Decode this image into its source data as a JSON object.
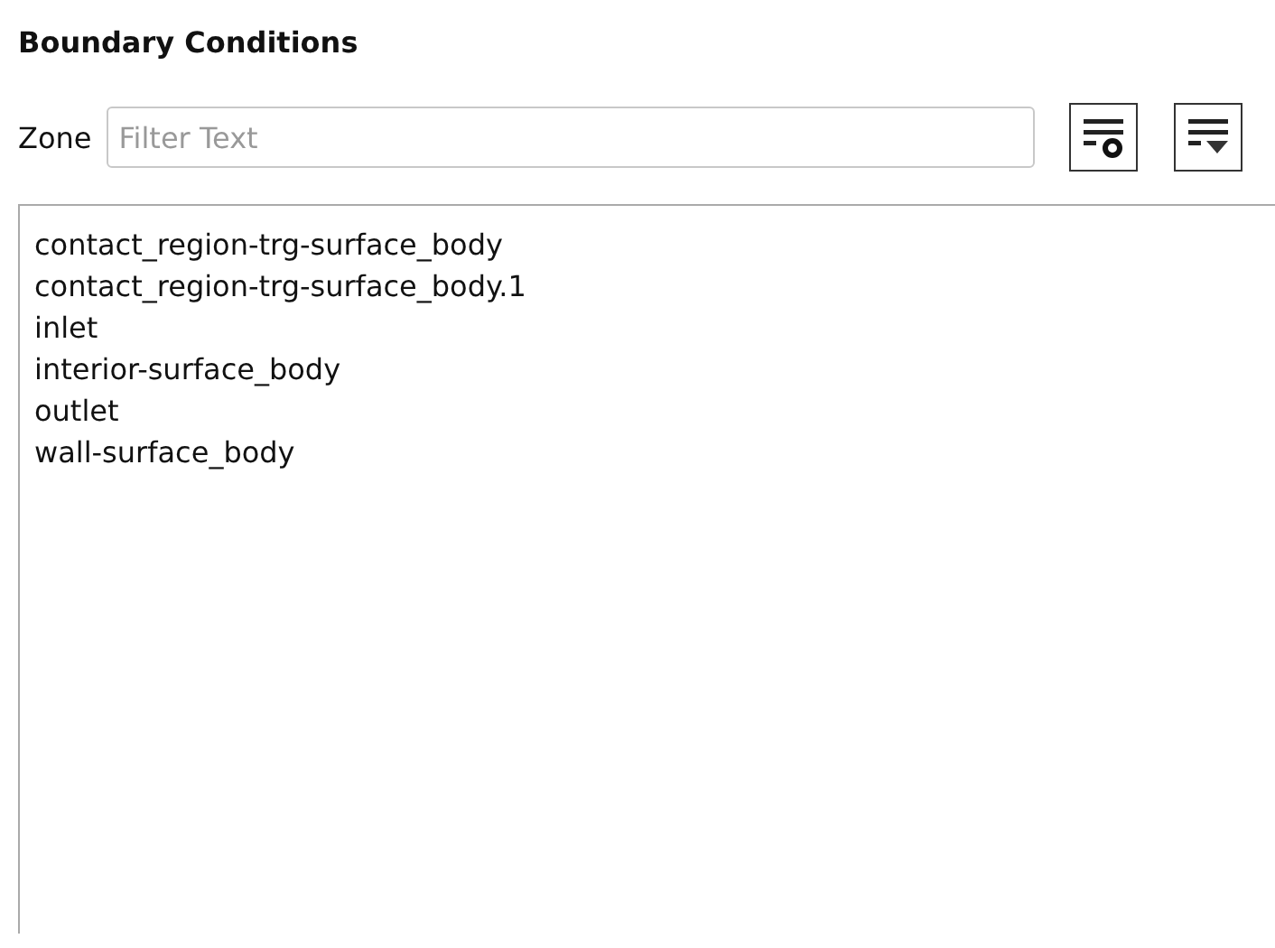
{
  "panel": {
    "title": "Boundary Conditions"
  },
  "filter": {
    "label": "Zone",
    "placeholder": "Filter Text"
  },
  "toolbar": [
    {
      "kind": "filter-options"
    },
    {
      "kind": "filter-dropdown"
    }
  ],
  "zones": [
    {
      "label": "contact_region-trg-surface_body",
      "selected": false
    },
    {
      "label": "contact_region-trg-surface_body.1",
      "selected": false
    },
    {
      "label": "inlet",
      "selected": false
    },
    {
      "label": "interior-surface_body",
      "selected": false
    },
    {
      "label": "outlet",
      "selected": false
    },
    {
      "label": "wall-surface_body",
      "selected": false
    }
  ]
}
